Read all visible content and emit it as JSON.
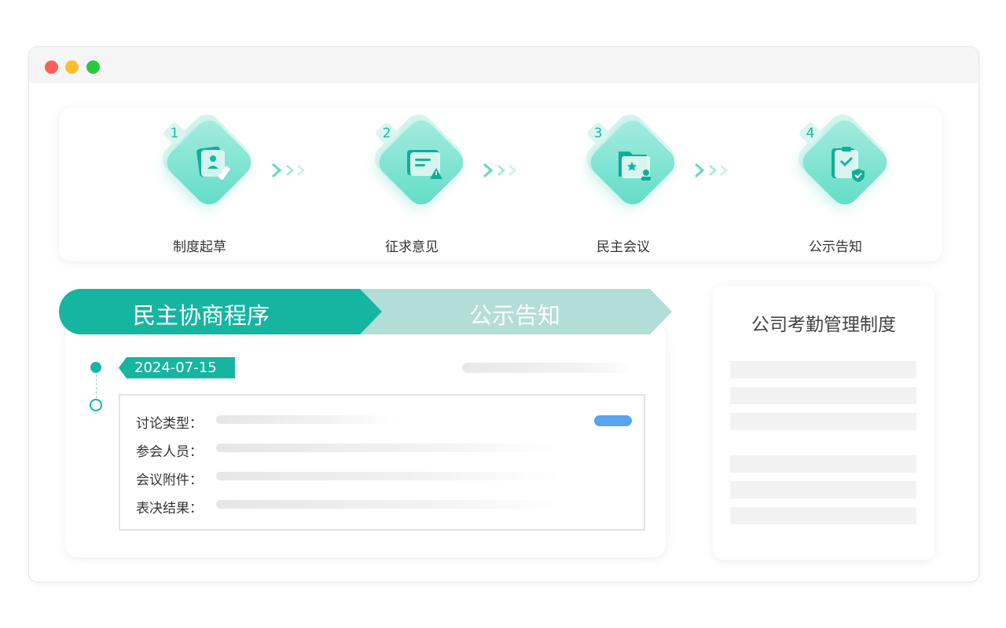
{
  "window": {
    "traffic_lights": [
      "close",
      "minimize",
      "maximize"
    ]
  },
  "steps": [
    {
      "number": "1",
      "label": "制度起草",
      "icon": "document-edit-icon"
    },
    {
      "number": "2",
      "label": "征求意见",
      "icon": "message-alert-icon"
    },
    {
      "number": "3",
      "label": "民主会议",
      "icon": "folder-star-icon"
    },
    {
      "number": "4",
      "label": "公示告知",
      "icon": "clipboard-check-icon"
    }
  ],
  "process": {
    "tabs": [
      {
        "label": "民主协商程序",
        "active": true
      },
      {
        "label": "公示告知",
        "active": false
      }
    ],
    "date": "2024-07-15",
    "fields": [
      {
        "label": "讨论类型："
      },
      {
        "label": "参会人员："
      },
      {
        "label": "会议附件："
      },
      {
        "label": "表决结果："
      }
    ]
  },
  "side_panel": {
    "title": "公司考勤管理制度"
  },
  "colors": {
    "accent": "#16b5a0",
    "accent_light": "#b3ddd7",
    "blue": "#58a4ef",
    "placeholder": "#f2f2f2"
  }
}
